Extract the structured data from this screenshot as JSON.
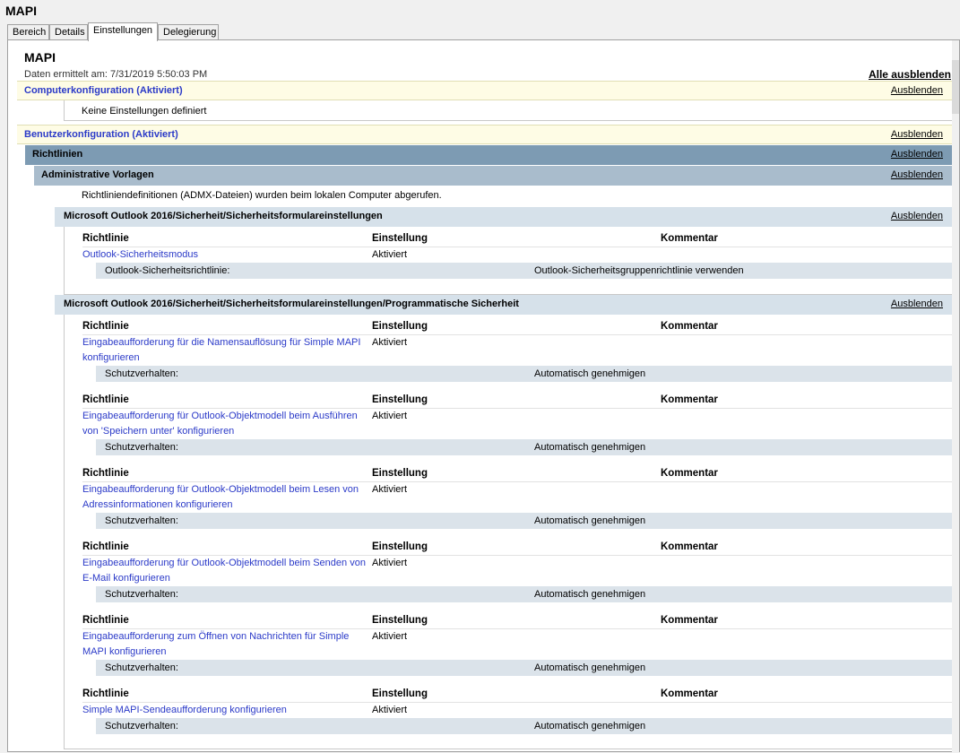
{
  "window": {
    "title": "MAPI"
  },
  "tabs": [
    "Bereich",
    "Details",
    "Einstellungen",
    "Delegierung"
  ],
  "active_tab": "Einstellungen",
  "report": {
    "title": "MAPI",
    "date_line": "Daten ermittelt am: 7/31/2019 5:50:03 PM",
    "hide_all": "Alle ausblenden",
    "hide": "Ausblenden"
  },
  "computer_config": {
    "label": "Computerkonfiguration (Aktiviert)",
    "no_settings": "Keine Einstellungen definiert"
  },
  "user_config": {
    "label": "Benutzerkonfiguration (Aktiviert)",
    "policies": "Richtlinien",
    "admin_templates": "Administrative Vorlagen",
    "admx_note": "Richtliniendefinitionen (ADMX-Dateien) wurden beim lokalen Computer abgerufen."
  },
  "columns": {
    "policy": "Richtlinie",
    "setting": "Einstellung",
    "comment": "Kommentar"
  },
  "section1": {
    "title": "Microsoft Outlook 2016/Sicherheit/Sicherheitsformulareinstellungen",
    "policy": "Outlook-Sicherheitsmodus",
    "setting": "Aktiviert",
    "sub_key": "Outlook-Sicherheitsrichtlinie:",
    "sub_value": "Outlook-Sicherheitsgruppenrichtlinie verwenden"
  },
  "section2": {
    "title": "Microsoft Outlook 2016/Sicherheit/Sicherheitsformulareinstellungen/Programmatische Sicherheit",
    "policies": [
      {
        "line1": "Eingabeaufforderung für die Namensauflösung für Simple MAPI",
        "line2": "konfigurieren",
        "setting": "Aktiviert",
        "sub_key": "Schutzverhalten:",
        "sub_value": "Automatisch genehmigen"
      },
      {
        "line1": "Eingabeaufforderung für Outlook-Objektmodell beim Ausführen",
        "line2": "von 'Speichern unter' konfigurieren",
        "setting": "Aktiviert",
        "sub_key": "Schutzverhalten:",
        "sub_value": "Automatisch genehmigen"
      },
      {
        "line1": "Eingabeaufforderung für Outlook-Objektmodell beim Lesen von",
        "line2": "Adressinformationen konfigurieren",
        "setting": "Aktiviert",
        "sub_key": "Schutzverhalten:",
        "sub_value": "Automatisch genehmigen"
      },
      {
        "line1": "Eingabeaufforderung für Outlook-Objektmodell beim Senden von",
        "line2": "E-Mail konfigurieren",
        "setting": "Aktiviert",
        "sub_key": "Schutzverhalten:",
        "sub_value": "Automatisch genehmigen"
      },
      {
        "line1": "Eingabeaufforderung zum Öffnen von Nachrichten für Simple",
        "line2": "MAPI konfigurieren",
        "setting": "Aktiviert",
        "sub_key": "Schutzverhalten:",
        "sub_value": "Automatisch genehmigen"
      },
      {
        "line1": "Simple MAPI-Sendeaufforderung konfigurieren",
        "line2": "",
        "setting": "Aktiviert",
        "sub_key": "Schutzverhalten:",
        "sub_value": "Automatisch genehmigen"
      }
    ]
  }
}
